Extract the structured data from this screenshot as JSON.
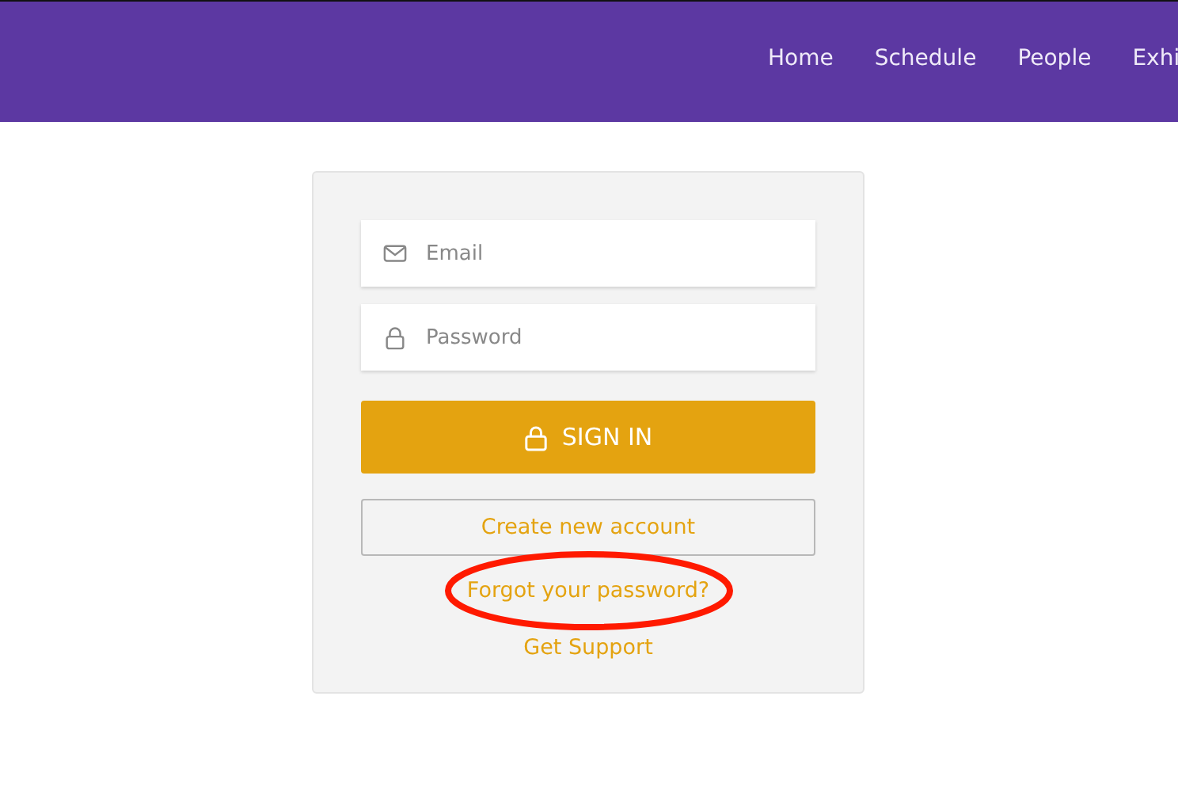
{
  "nav": {
    "items": [
      {
        "label": "Home"
      },
      {
        "label": "Schedule"
      },
      {
        "label": "People"
      },
      {
        "label": "Exhi"
      }
    ]
  },
  "login": {
    "fields": [
      {
        "kind": "email",
        "placeholder": "Email"
      },
      {
        "kind": "password",
        "placeholder": "Password"
      }
    ],
    "sign_in": "SIGN IN",
    "create_account": "Create new account",
    "forgot_password": "Forgot your password?",
    "support": "Get Support"
  },
  "annotations": [
    {
      "kind": "ellipse"
    }
  ]
}
